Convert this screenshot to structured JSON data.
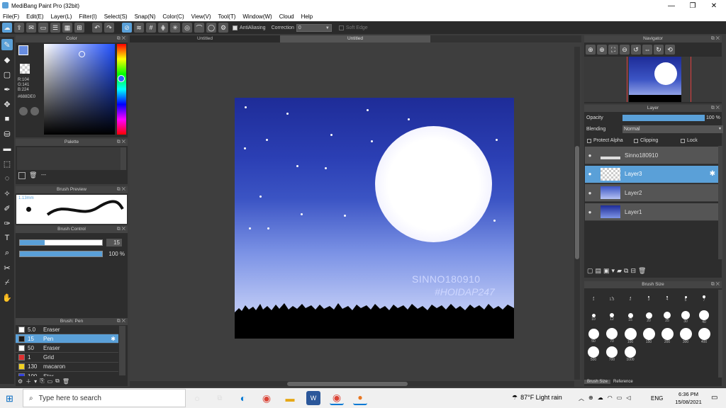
{
  "window": {
    "title": "MediBang Paint Pro (32bit)",
    "min": "—",
    "max": "❐",
    "close": "✕"
  },
  "menu": [
    "File(F)",
    "Edit(E)",
    "Layer(L)",
    "Filter(I)",
    "Select(S)",
    "Snap(N)",
    "Color(C)",
    "View(V)",
    "Tool(T)",
    "Window(W)",
    "Cloud",
    "Help"
  ],
  "toolbar": {
    "antialias_label": "AntiAliasing",
    "correction_label": "Correction",
    "correction_value": "0",
    "softedge_label": "Soft Edge"
  },
  "tabs": [
    "Untitled",
    "Untitled"
  ],
  "color_panel": {
    "title": "Color",
    "r": "R:104",
    "g": "G:141",
    "b": "B:224",
    "hex": "#688DE0"
  },
  "palette_panel": {
    "title": "Palette",
    "dash": "---"
  },
  "brush_preview": {
    "title": "Brush Preview",
    "size": "1.13mm"
  },
  "brush_control": {
    "title": "Brush Control",
    "size_value": "15",
    "opacity_value": "100 %"
  },
  "brush_list": {
    "title": "Brush: Pen",
    "items": [
      {
        "size": "5.0",
        "name": "Eraser",
        "color": "#ffffff"
      },
      {
        "size": "15",
        "name": "Pen",
        "color": "#1a1a1a",
        "selected": true
      },
      {
        "size": "50",
        "name": "Eraser",
        "color": "#ffffff"
      },
      {
        "size": "1",
        "name": "Grid",
        "color": "#e03030"
      },
      {
        "size": "130",
        "name": "macaron",
        "color": "#f0d020"
      },
      {
        "size": "100",
        "name": "Star",
        "color": "#3040e0"
      }
    ]
  },
  "canvas": {
    "watermark1": "SINNO180910",
    "watermark2": "#HOIDAP247"
  },
  "navigator": {
    "title": "Navigator"
  },
  "layer_panel": {
    "title": "Layer",
    "opacity_label": "Opacity",
    "opacity_value": "100 %",
    "opacity_fraction": 1.0,
    "blending_label": "Blending",
    "blending_value": "Normal",
    "protect_alpha": "Protect Alpha",
    "clipping": "Clipping",
    "lock": "Lock",
    "layers": [
      {
        "name": "Sinno180910"
      },
      {
        "name": "Layer3",
        "selected": true
      },
      {
        "name": "Layer2"
      },
      {
        "name": "Layer1"
      }
    ]
  },
  "brush_size": {
    "title": "Brush Size",
    "tab1": "Brush Size",
    "tab2": "Reference",
    "row1": [
      "1",
      "1.5",
      "2",
      "3",
      "4",
      "5",
      "7"
    ],
    "row2": [
      "10",
      "12",
      "15",
      "20",
      "25",
      "30",
      "40"
    ],
    "row3": [
      "50",
      "70",
      "100",
      "150",
      "200",
      "300",
      "400"
    ],
    "row4": [
      "500",
      "700",
      "1000"
    ]
  },
  "taskbar": {
    "search_placeholder": "Type here to search",
    "weather": "87°F  Light rain",
    "lang": "ENG",
    "time": "6:36 PM",
    "date": "15/08/2021"
  }
}
